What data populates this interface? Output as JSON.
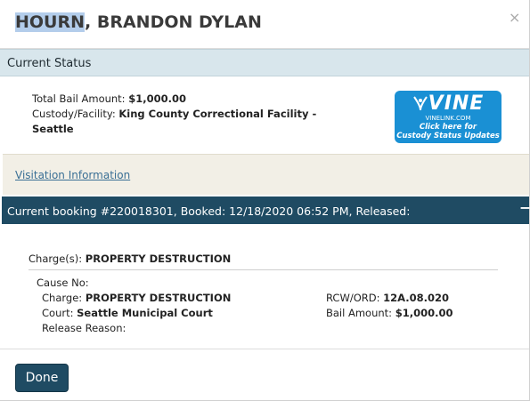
{
  "modal": {
    "title_last": "HOURN",
    "title_rest": ", BRANDON DYLAN",
    "close_glyph": "×"
  },
  "current_status": {
    "heading": "Current Status",
    "total_bail_label": "Total Bail Amount:",
    "total_bail_value": "$1,000.00",
    "facility_label": "Custody/Facility:",
    "facility_value_line1": "King County Correctional Facility -",
    "facility_value_line2": "Seattle"
  },
  "vine": {
    "logo": "VINE",
    "site": "VINELINK.COM",
    "line1": "Click here for",
    "line2": "Custody Status Updates"
  },
  "visitation": {
    "link": "Visitation Information"
  },
  "booking": {
    "header": "Current booking #220018301, Booked: 12/18/2020 06:52 PM, Released:",
    "collapse_glyph": "−",
    "charges_label": "Charge(s):",
    "charges_value": "PROPERTY DESTRUCTION",
    "cause_no_label": "Cause No:",
    "charge_label": "Charge:",
    "charge_value": "PROPERTY DESTRUCTION",
    "court_label": "Court:",
    "court_value": "Seattle Municipal Court",
    "release_reason_label": "Release Reason:",
    "rcw_label": "RCW/ORD:",
    "rcw_value": "12A.08.020",
    "bail_label": "Bail Amount:",
    "bail_value": "$1,000.00"
  },
  "footer": {
    "done_label": "Done"
  },
  "colors": {
    "header_bar": "#d8e6ec",
    "booking_bar": "#1f4b63",
    "vine_blue": "#1a90d4",
    "visitation_bg": "#f2efe6",
    "link": "#3a6f95"
  }
}
